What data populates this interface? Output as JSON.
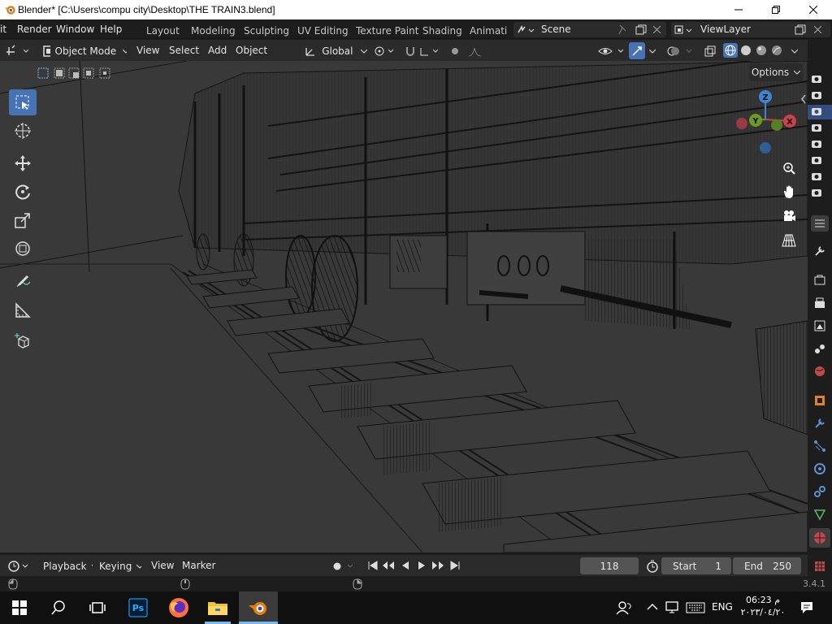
{
  "window": {
    "title": "Blender* [C:\\Users\\compu city\\Desktop\\THE TRAIN3.blend]"
  },
  "topbar": {
    "menus": [
      "Render",
      "Window",
      "Help"
    ],
    "menu_cut": "it",
    "workspaces": [
      "Layout",
      "Modeling",
      "Sculpting",
      "UV Editing",
      "Texture Paint",
      "Shading",
      "Animati"
    ],
    "scene": "Scene",
    "view_layer": "ViewLayer"
  },
  "header": {
    "mode": "Object Mode",
    "menus": [
      "View",
      "Select",
      "Add",
      "Object"
    ],
    "orientation": "Global",
    "options_label": "Options"
  },
  "navigation_gizmo": {
    "axes": [
      "Z",
      "Y",
      "X"
    ],
    "colors": {
      "x": "#c9414a",
      "y": "#6c9a27",
      "z": "#3a85d4"
    }
  },
  "timeline": {
    "menus": [
      "Playback",
      "Keying",
      "View",
      "Marker"
    ],
    "current_frame": "118",
    "start_label": "Start",
    "start": "1",
    "end_label": "End",
    "end": "250"
  },
  "status": {
    "version": "3.4.1"
  },
  "taskbar": {
    "language": "ENG",
    "time": "06:23 م",
    "date": "۲۰۲۳/۰٤/۲۰"
  },
  "colors": {
    "accent": "#4772b3",
    "viewport_bg": "#393939",
    "panel_bg": "#2a2a2a"
  }
}
